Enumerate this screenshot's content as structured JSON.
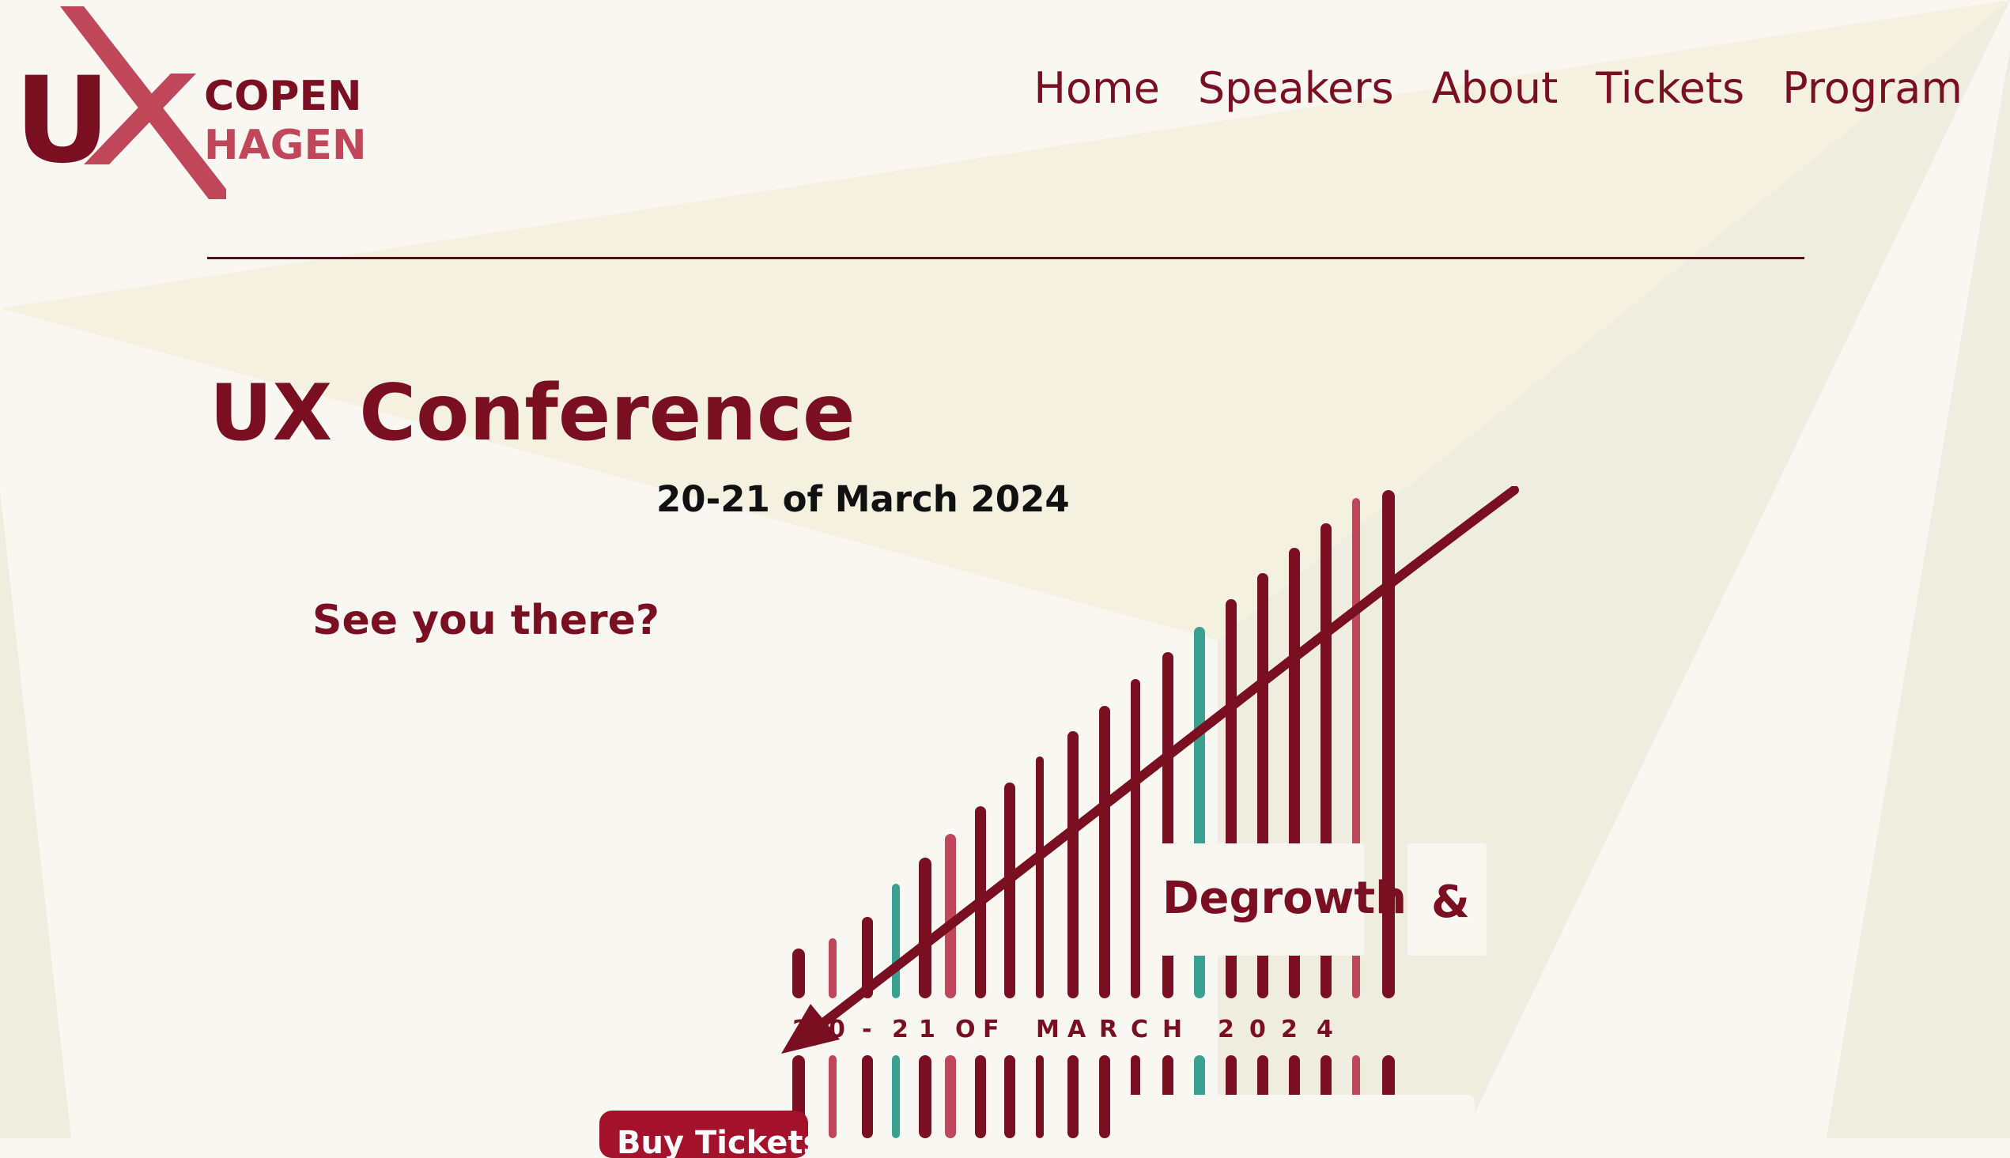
{
  "logo": {
    "u": "U",
    "line1": "COPEN",
    "line2": "HAGEN"
  },
  "nav": [
    {
      "label": "Home"
    },
    {
      "label": "Speakers"
    },
    {
      "label": "About"
    },
    {
      "label": "Tickets"
    },
    {
      "label": "Program"
    }
  ],
  "hero": {
    "title": "UX Conference",
    "dates": "20-21 of March 2024",
    "tagline": "See you there?"
  },
  "graphic": {
    "word1": "Degrowth",
    "word2": "&",
    "row_chars": [
      "2",
      "0",
      "-",
      "2",
      "1",
      "O",
      "F",
      "M",
      "A",
      "R",
      "C",
      "H",
      "2",
      "0",
      "2",
      "4"
    ]
  },
  "cta": {
    "label": "Buy Tickets"
  },
  "colors": {
    "primary": "#7a0f22",
    "accent": "#c04759",
    "teal": "#3aa090",
    "background": "#f8f7f1"
  }
}
